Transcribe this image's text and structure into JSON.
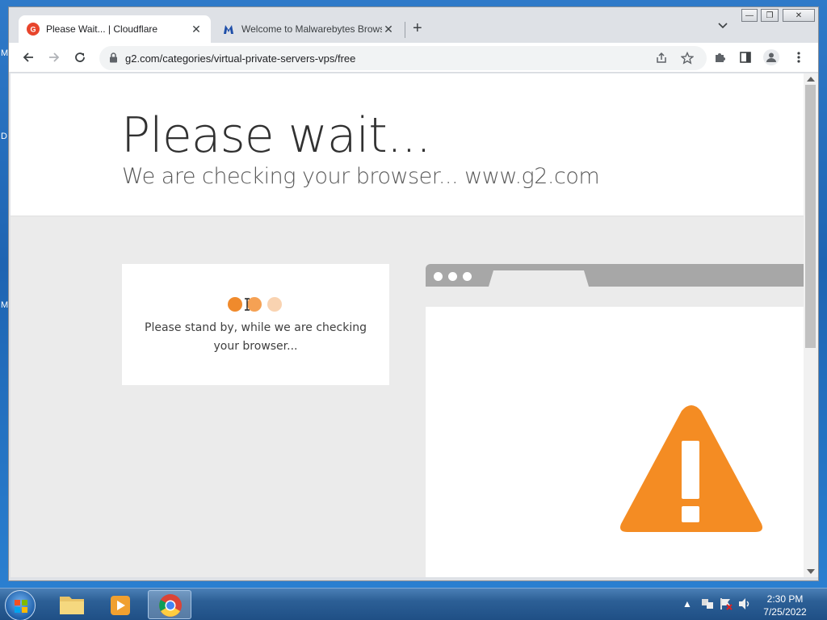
{
  "desktop": {
    "side_letters": [
      "M",
      "D",
      "M"
    ]
  },
  "browser": {
    "tabs": [
      {
        "title": "Please Wait... | Cloudflare",
        "favicon": "g2-favicon",
        "active": true
      },
      {
        "title": "Welcome to Malwarebytes Brows",
        "favicon": "malwarebytes-favicon",
        "active": false
      }
    ],
    "new_tab_label": "+",
    "url": "g2.com/categories/virtual-private-servers-vps/free"
  },
  "page": {
    "title": "Please wait...",
    "subtitle": "We are checking your browser... www.g2.com",
    "status_text": "Please stand by, while we are checking your browser...",
    "dots_colors": [
      "#f08a2c",
      "#f5a154",
      "#f9d3b1"
    ],
    "accent": "#f48c23"
  },
  "taskbar": {
    "time": "2:30 PM",
    "date": "7/25/2022"
  }
}
